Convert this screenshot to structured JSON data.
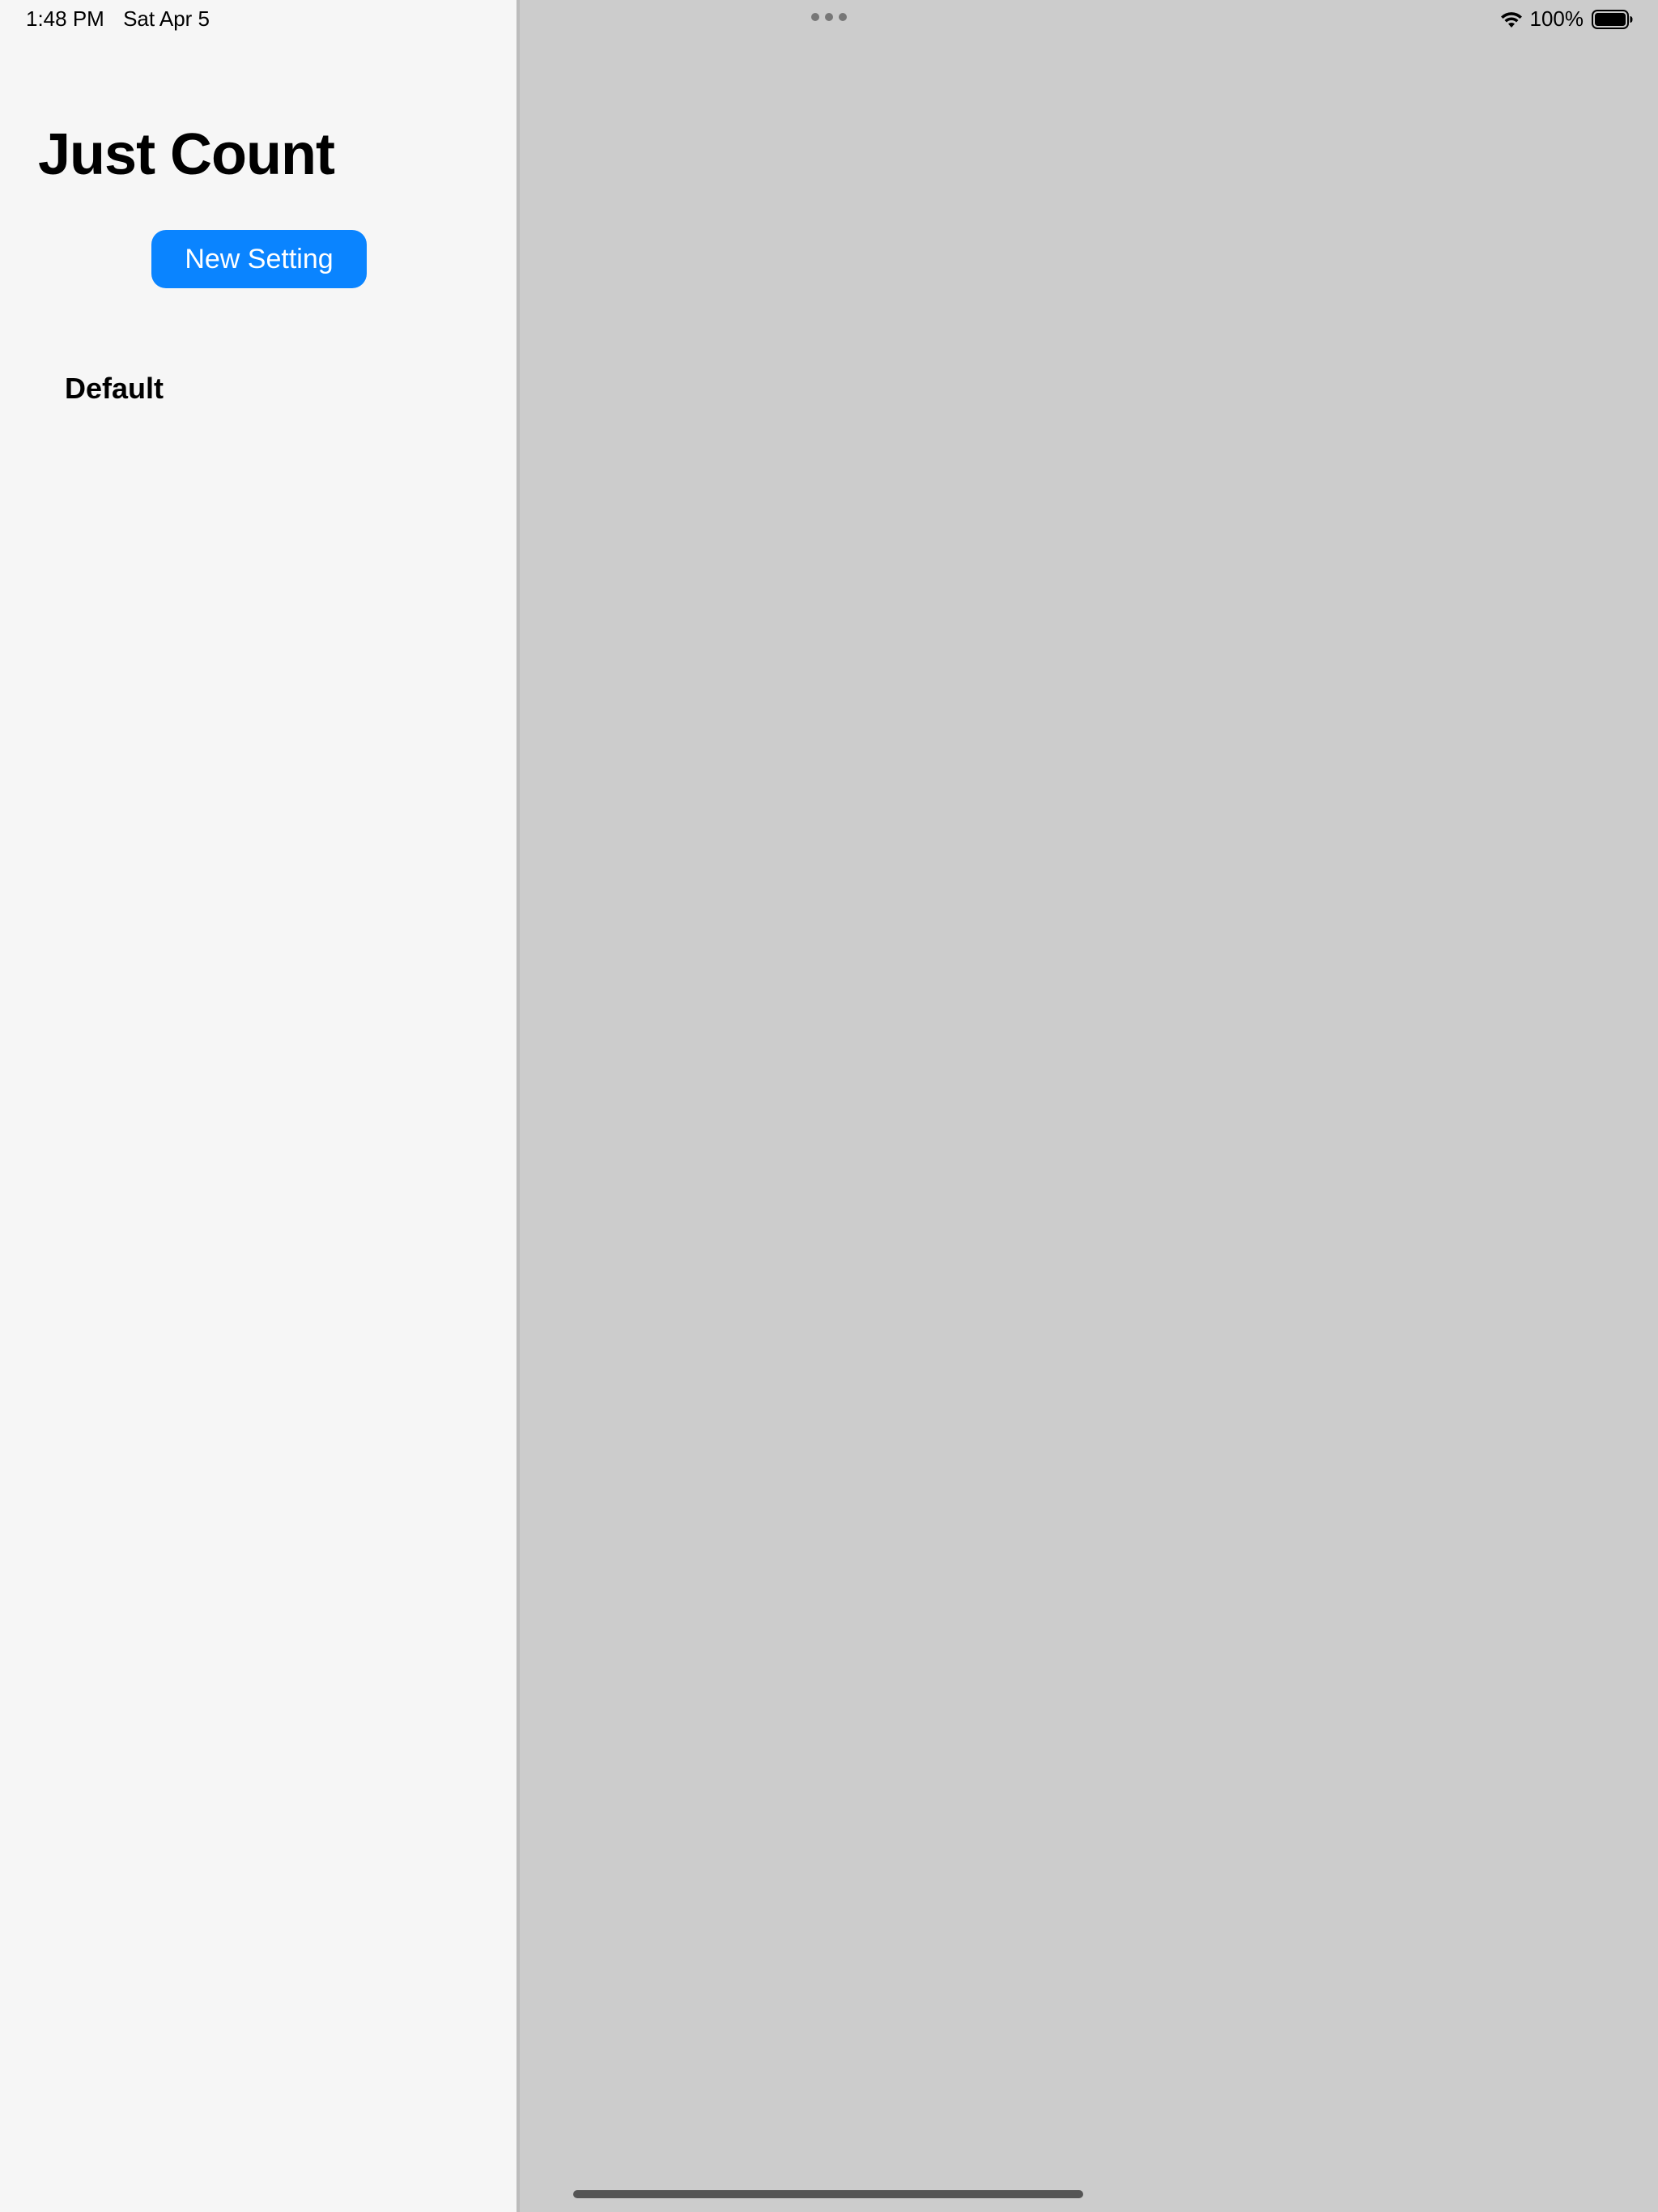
{
  "status_bar": {
    "time": "1:48 PM",
    "date": "Sat Apr 5",
    "battery_percent": "100%",
    "wifi_icon": "wifi-icon",
    "battery_icon": "battery-full-icon"
  },
  "sidebar": {
    "title": "Just Count",
    "new_setting_label": "New Setting",
    "items": [
      {
        "label": "Default"
      }
    ]
  },
  "colors": {
    "accent": "#0a84ff",
    "sidebar_bg": "#f6f6f6",
    "detail_bg": "#cccccc"
  }
}
